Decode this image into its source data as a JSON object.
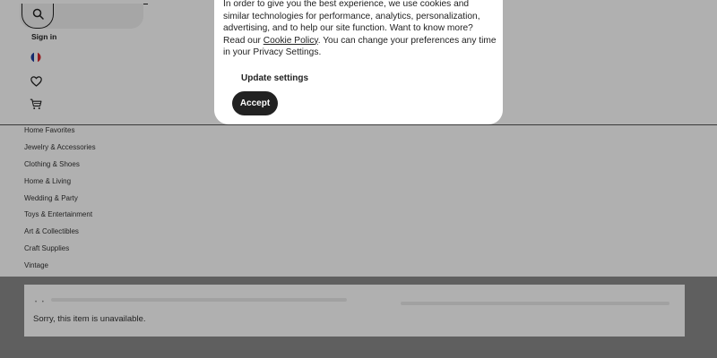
{
  "header": {
    "sign_in_label": "Sign in"
  },
  "categories": [
    "Home Favorites",
    "Jewelry & Accessories",
    "Clothing & Shoes",
    "Home & Living",
    "Wedding & Party",
    "Toys & Entertainment",
    "Art & Collectibles",
    "Craft Supplies",
    "Vintage"
  ],
  "listing": {
    "unavailable_message": "Sorry, this item is unavailable."
  },
  "cookie_modal": {
    "text_before_link": "In order to give you the best experience, we use cookies and similar technologies for performance, analytics, personalization, advertising, and to help our site function. Want to know more? Read our ",
    "link_text": "Cookie Policy",
    "text_after_link": ". You can change your preferences any time in your Privacy Settings.",
    "update_settings_label": "Update settings",
    "accept_label": "Accept"
  },
  "colors": {
    "overlay": "rgba(0,0,0,0.31)",
    "accept_button_bg": "#222222",
    "flag_blue": "#1f3fa0",
    "flag_red": "#d8282e"
  },
  "icons": [
    "search-icon",
    "france-flag-icon",
    "heart-icon",
    "cart-icon"
  ]
}
